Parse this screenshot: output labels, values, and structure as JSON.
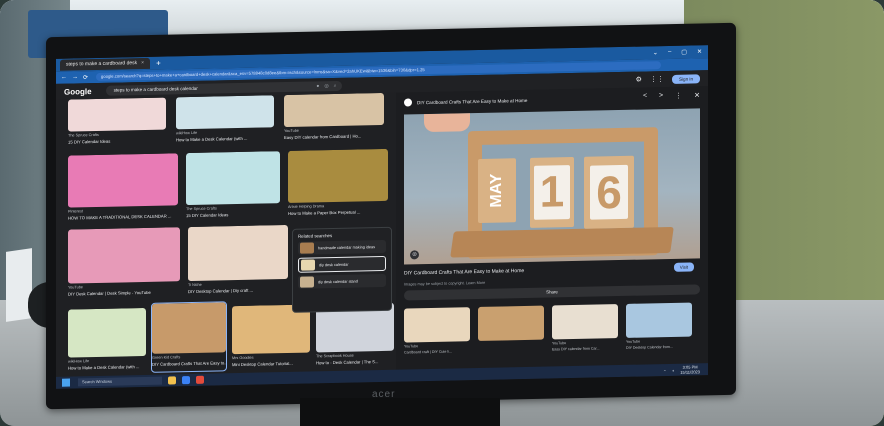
{
  "browser": {
    "tab_title": "steps to make a cardboard desk",
    "tab_close": "×",
    "new_tab": "+",
    "window_controls": [
      "⌄",
      "–",
      "▢",
      "✕"
    ],
    "url": "google.com/search?q=steps+to+make+a+cardboard+desk+calendar&sca_esv=578848c0d8ee&tbm=isch&source=lnms&sa=X&ved=2ahUKEwi&biw=1536&bih=730&dpr=1.25"
  },
  "google": {
    "logo": "Google",
    "search_query": "steps to make a cardboard desk calendar",
    "sign_in": "Sign in"
  },
  "results": [
    {
      "source": "The Spruce Crafts",
      "title": "15 DIY Calendar Ideas",
      "color": "#f0d9d9"
    },
    {
      "source": "wikiHow Life",
      "title": "How to Make a Desk Calendar (with ...",
      "color": "#cfe3ea"
    },
    {
      "source": "YouTube",
      "title": "Easy DIY calendar from Cardboard | Ho...",
      "color": "#d8c3a5"
    },
    {
      "source": "Pinterest",
      "title": "HOW TO MAKE A TRADITIONAL DESK CALENDAR ...",
      "color": "#e87bb5"
    },
    {
      "source": "The Spruce Crafts",
      "title": "15 DIY Calendar Ideas",
      "color": "#bfe3e6"
    },
    {
      "source": "Artsie Helping Drama",
      "title": "How to Make a Paper Box Perpetual ...",
      "color": "#a98c3f"
    },
    {
      "source": "YouTube",
      "title": "DIY Desk Calendar | Desk Simple - YouTube",
      "color": "#e79ab8"
    },
    {
      "source": "Ti Niche",
      "title": "DIY Desktop Calendar | Diy craft ...",
      "color": "#ead7c8"
    },
    {
      "source": "wikiHow Life",
      "title": "How to Make a Desk Calendar (with ...",
      "color": "#d6e7c4"
    },
    {
      "source": "Green Kid Crafts",
      "title": "DIY Cardboard Crafts That Are Easy to...",
      "color": "#c79a6a"
    },
    {
      "source": "Mrs Goodies",
      "title": "Mini Desktop Calendar Tutorial...",
      "color": "#e0b77a"
    },
    {
      "source": "The Scrapbook House",
      "title": "How to - Desk Calendar | The S...",
      "color": "#d0d4dc"
    }
  ],
  "related": {
    "heading": "Related searches",
    "items": [
      "handmade calendar making ideas",
      "diy desk calendar",
      "diy desk calendar stand"
    ]
  },
  "preview": {
    "source": "DIY Cardboard Crafts That Are Easy to Make at Home",
    "controls": [
      "<",
      ">",
      "⋮",
      "✕"
    ],
    "blocks": [
      "MAY",
      "1",
      "6"
    ],
    "caption": "DIY Cardboard Crafts That Are Easy to Make at Home",
    "visit": "Visit",
    "copyright": "Images may be subject to copyright. Learn More",
    "share": "Share",
    "related_images": [
      {
        "caption": "YouTube",
        "sub": "Cardboard craft | DIY Cute li...",
        "color": "#e9d7bd"
      },
      {
        "caption": "",
        "sub": "",
        "color": "#c9a06f"
      },
      {
        "caption": "YouTube",
        "sub": "Easy DIY calendar from Car...",
        "color": "#e8dfd1"
      },
      {
        "caption": "YouTube",
        "sub": "DIY Desktop Calendar from...",
        "color": "#a9c7e0"
      }
    ]
  },
  "taskbar": {
    "search_placeholder": "Search Windows",
    "time": "3:05 PM",
    "date": "15/11/2023"
  },
  "monitor_brand": "acer"
}
